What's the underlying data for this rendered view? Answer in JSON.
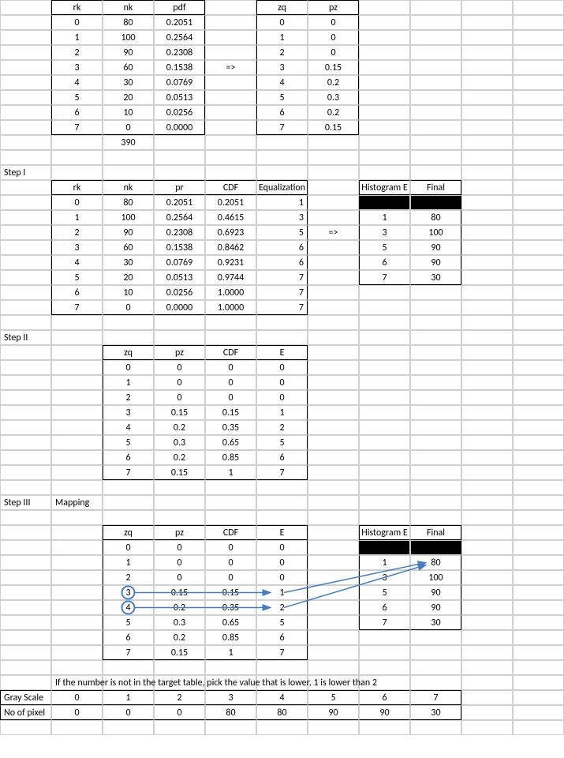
{
  "top": {
    "t1": {
      "headers": [
        "rk",
        "nk",
        "pdf"
      ],
      "rows": [
        [
          "0",
          "80",
          "0.2051"
        ],
        [
          "1",
          "100",
          "0.2564"
        ],
        [
          "2",
          "90",
          "0.2308"
        ],
        [
          "3",
          "60",
          "0.1538"
        ],
        [
          "4",
          "30",
          "0.0769"
        ],
        [
          "5",
          "20",
          "0.0513"
        ],
        [
          "6",
          "10",
          "0.0256"
        ],
        [
          "7",
          "0",
          "0.0000"
        ]
      ],
      "sum": "390"
    },
    "arrow": "=>",
    "t2": {
      "headers": [
        "zq",
        "pz"
      ],
      "rows": [
        [
          "0",
          "0"
        ],
        [
          "1",
          "0"
        ],
        [
          "2",
          "0"
        ],
        [
          "3",
          "0.15"
        ],
        [
          "4",
          "0.2"
        ],
        [
          "5",
          "0.3"
        ],
        [
          "6",
          "0.2"
        ],
        [
          "7",
          "0.15"
        ]
      ]
    }
  },
  "step1": {
    "label": "Step I",
    "t1": {
      "headers": [
        "rk",
        "nk",
        "pr",
        "CDF",
        "Equalization"
      ],
      "rows": [
        [
          "0",
          "80",
          "0.2051",
          "0.2051",
          "1"
        ],
        [
          "1",
          "100",
          "0.2564",
          "0.4615",
          "3"
        ],
        [
          "2",
          "90",
          "0.2308",
          "0.6923",
          "5"
        ],
        [
          "3",
          "60",
          "0.1538",
          "0.8462",
          "6"
        ],
        [
          "4",
          "30",
          "0.0769",
          "0.9231",
          "6"
        ],
        [
          "5",
          "20",
          "0.0513",
          "0.9744",
          "7"
        ],
        [
          "6",
          "10",
          "0.0256",
          "1.0000",
          "7"
        ],
        [
          "7",
          "0",
          "0.0000",
          "1.0000",
          "7"
        ]
      ]
    },
    "arrow": "=>",
    "t2": {
      "headers": [
        "Histogram E",
        "Final"
      ],
      "rows": [
        [
          "1",
          "80"
        ],
        [
          "3",
          "100"
        ],
        [
          "5",
          "90"
        ],
        [
          "6",
          "90"
        ],
        [
          "7",
          "30"
        ]
      ]
    }
  },
  "step2": {
    "label": "Step II",
    "t1": {
      "headers": [
        "zq",
        "pz",
        "CDF",
        "E"
      ],
      "rows": [
        [
          "0",
          "0",
          "0",
          "0"
        ],
        [
          "1",
          "0",
          "0",
          "0"
        ],
        [
          "2",
          "0",
          "0",
          "0"
        ],
        [
          "3",
          "0.15",
          "0.15",
          "1"
        ],
        [
          "4",
          "0.2",
          "0.35",
          "2"
        ],
        [
          "5",
          "0.3",
          "0.65",
          "5"
        ],
        [
          "6",
          "0.2",
          "0.85",
          "6"
        ],
        [
          "7",
          "0.15",
          "1",
          "7"
        ]
      ]
    }
  },
  "step3": {
    "label": "Step III",
    "sublabel": "Mapping",
    "t1": {
      "headers": [
        "zq",
        "pz",
        "CDF",
        "E"
      ],
      "rows": [
        [
          "0",
          "0",
          "0",
          "0"
        ],
        [
          "1",
          "0",
          "0",
          "0"
        ],
        [
          "2",
          "0",
          "0",
          "0"
        ],
        [
          "3",
          "0.15",
          "0.15",
          "1"
        ],
        [
          "4",
          "0.2",
          "0.35",
          "2"
        ],
        [
          "5",
          "0.3",
          "0.65",
          "5"
        ],
        [
          "6",
          "0.2",
          "0.85",
          "6"
        ],
        [
          "7",
          "0.15",
          "1",
          "7"
        ]
      ]
    },
    "t2": {
      "headers": [
        "Histogram E",
        "Final"
      ],
      "rows": [
        [
          "1",
          "80"
        ],
        [
          "3",
          "100"
        ],
        [
          "5",
          "90"
        ],
        [
          "6",
          "90"
        ],
        [
          "7",
          "30"
        ]
      ]
    }
  },
  "note": "If the number is not in the target table, pick the value that is lower, 1 is lower than 2",
  "final": {
    "row1_label": "Gray Scale",
    "row1": [
      "0",
      "1",
      "2",
      "3",
      "4",
      "5",
      "6",
      "7"
    ],
    "row2_label": "No of pixel",
    "row2": [
      "0",
      "0",
      "0",
      "80",
      "80",
      "90",
      "90",
      "30"
    ]
  }
}
